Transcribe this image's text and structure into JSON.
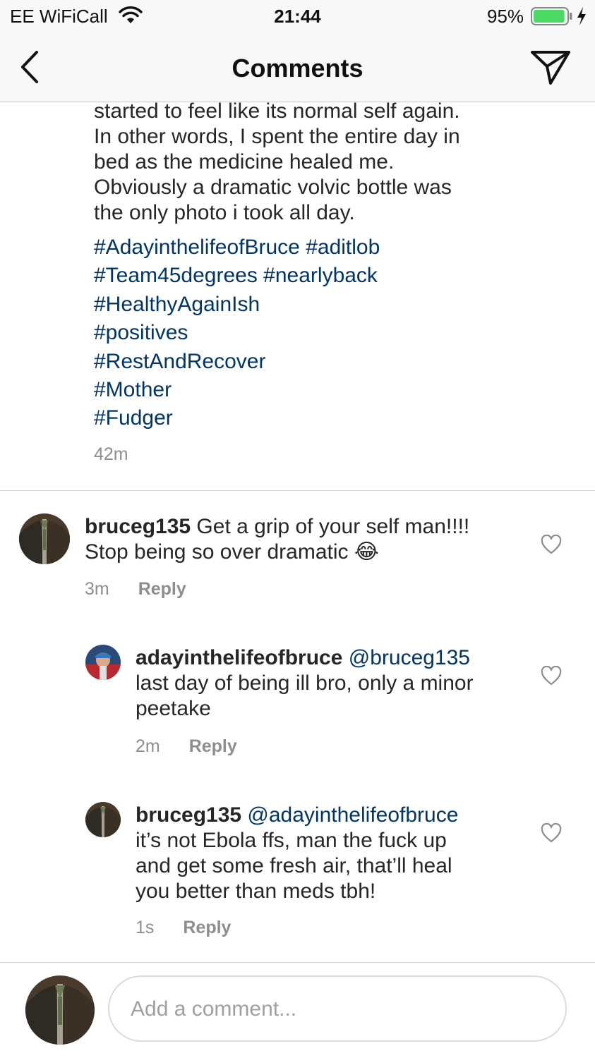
{
  "status_bar": {
    "carrier": "EE WiFiCall",
    "time": "21:44",
    "battery_percent": "95%",
    "battery_level": 0.95,
    "battery_color": "#4cd964",
    "icons": [
      "wifi-icon",
      "battery-icon",
      "charging-bolt-icon"
    ]
  },
  "nav": {
    "title": "Comments",
    "back_icon": "chevron-left-icon",
    "send_icon": "direct-send-icon"
  },
  "caption": {
    "lines": [
      "started to feel like its normal self again.",
      "In other words, I spent the entire day in",
      "bed as the medicine healed me.",
      "Obviously a dramatic volvic bottle was",
      "the only photo i took all day."
    ],
    "hashtag_lines": [
      [
        "#AdayinthelifeofBruce",
        "#aditlob"
      ],
      [
        "#Team45degrees",
        "#nearlyback"
      ],
      [
        "#HealthyAgainIsh"
      ],
      [
        "#positives"
      ],
      [
        "#RestAndRecover"
      ],
      [
        "#Mother"
      ],
      [
        "#Fudger"
      ]
    ],
    "time": "42m"
  },
  "comments": [
    {
      "username": "bruceg135",
      "mention": "",
      "text_line1": "Get a grip of your self man!!!!",
      "text_line2": "Stop being so over dramatic 😂",
      "text_line3": "",
      "time": "3m",
      "reply_label": "Reply"
    },
    {
      "username": "adayinthelifeofbruce",
      "mention": "@bruceg135",
      "text_line1": "last day of being ill bro, only a minor",
      "text_line2": "peetake",
      "text_line3": "",
      "time": "2m",
      "reply_label": "Reply"
    },
    {
      "username": "bruceg135",
      "mention": "@adayinthelifeofbruce",
      "text_line1": "it’s not Ebola ffs, man the fuck up",
      "text_line2": "and get some fresh air, that’ll heal",
      "text_line3": "you better than meds tbh!",
      "time": "1s",
      "reply_label": "Reply"
    }
  ],
  "composer": {
    "placeholder": "Add a comment..."
  },
  "colors": {
    "hashtag": "#003569",
    "muted_text": "#8e8e8e",
    "bar_background": "#f8f8f8"
  }
}
